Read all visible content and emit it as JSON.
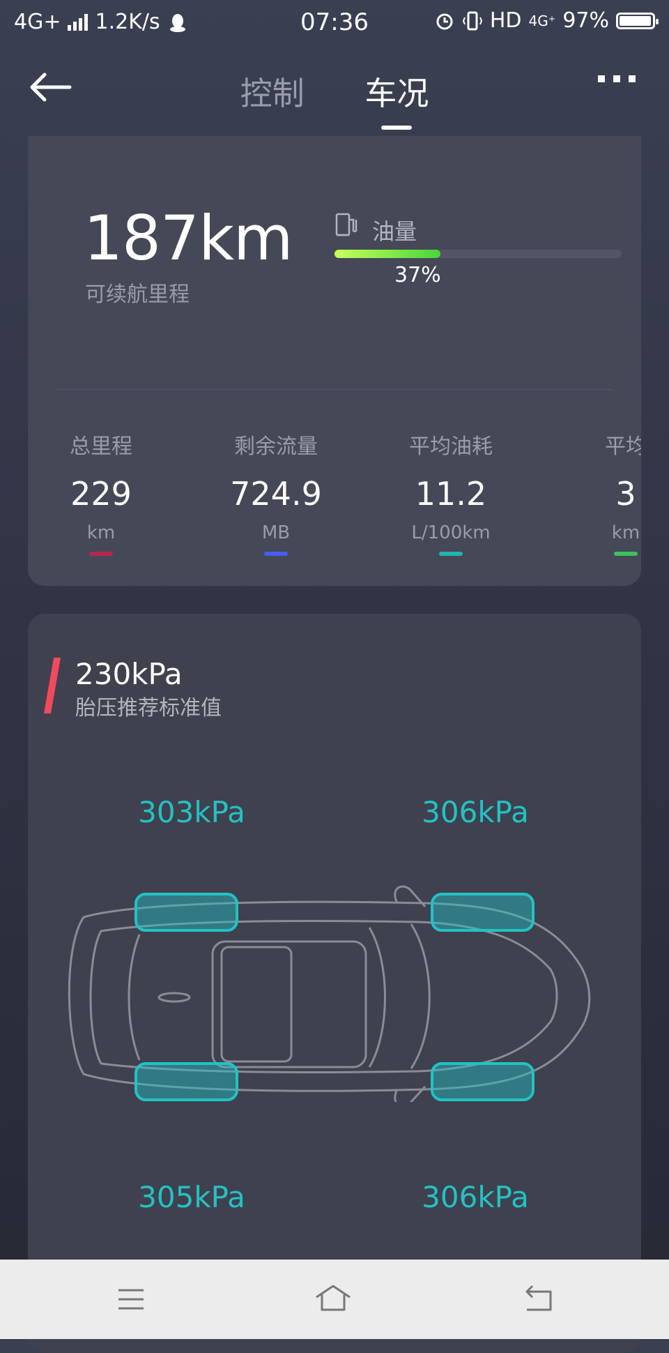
{
  "status_bar": {
    "network": "4G+",
    "speed": "1.2K/s",
    "time": "07:36",
    "hd": "HD",
    "net2": "4G⁺",
    "battery_pct": "97%",
    "battery_level": 0.97
  },
  "nav": {
    "tabs": [
      {
        "label": "控制",
        "active": false
      },
      {
        "label": "车况",
        "active": true
      }
    ]
  },
  "summary": {
    "range_value": "187km",
    "range_label": "可续航里程",
    "fuel_label": "油量",
    "fuel_percent": "37%",
    "fuel_level": 0.37,
    "fuel_bar_colors": [
      "#c7ff5a",
      "#47d63a"
    ]
  },
  "stats": [
    {
      "label": "总里程",
      "value": "229",
      "unit": "km",
      "color": "#b3264f"
    },
    {
      "label": "剩余流量",
      "value": "724.9",
      "unit": "MB",
      "color": "#4a5cf0"
    },
    {
      "label": "平均油耗",
      "value": "11.2",
      "unit": "L/100km",
      "color": "#1fb5b0"
    },
    {
      "label": "平均",
      "value": "3",
      "unit": "km",
      "color": "#3cc25a"
    }
  ],
  "tire": {
    "standard_value": "230kPa",
    "standard_label": "胎压推荐标准值",
    "front_left": "303kPa",
    "front_right": "306kPa",
    "rear_left": "305kPa",
    "rear_right": "306kPa",
    "accent_color": "#23c2c4"
  }
}
